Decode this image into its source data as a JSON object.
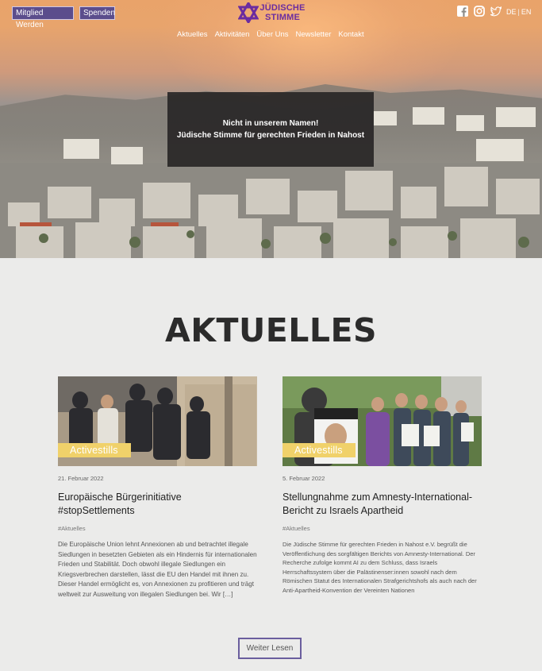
{
  "header": {
    "member_button": "Mitglied Werden",
    "donate_button": "Spenden",
    "logo_text_line1": "JÜDISCHE",
    "logo_text_line2": "STIMME",
    "nav": [
      "Aktuelles",
      "Aktivitäten",
      "Über Uns",
      "Newsletter",
      "Kontakt"
    ],
    "social_icons": [
      "facebook-icon",
      "instagram-icon",
      "twitter-icon"
    ],
    "lang_de": "DE",
    "lang_sep": "|",
    "lang_en": "EN"
  },
  "hero": {
    "line1": "Nicht in unserem Namen!",
    "line2": "Jüdische Stimme für gerechten Frieden in Nahost"
  },
  "section": {
    "title": "AKTUELLES"
  },
  "posts": [
    {
      "badge": "Activestills",
      "date": "21. Februar 2022",
      "title": "Europäische Bürgerinitiative #stopSettlements",
      "tag": "#Aktuelles",
      "excerpt": "Die Europäische Union lehnt Annexionen ab und betrachtet illegale Siedlungen in besetzten Gebieten als ein Hindernis für internationalen Frieden und Stabilität. Doch obwohl illegale Siedlungen ein Kriegsverbrechen darstellen, lässt die EU den Handel mit ihnen zu. Dieser Handel ermöglicht es, von Annexionen zu profitieren und trägt weltweit zur Ausweitung von illegalen Siedlungen bei. Wir […]"
    },
    {
      "badge": "Activestills",
      "date": "5. Februar 2022",
      "title": "Stellungnahme zum Amnesty-International-Bericht zu Israels Apartheid",
      "tag": "#Aktuelles",
      "excerpt": "Die Jüdische Stimme für gerechten Frieden in Nahost e.V. begrüßt die Veröffentlichung des sorgfältigen Berichts von Amnesty-International. Der Recherche zufolge kommt AI zu dem Schluss, dass Israels Herrschaftssystem über die Palästinenser:innen sowohl nach dem Römischen Statut des Internationalen Strafgerichtshofs als auch nach der Anti-Apartheid-Konvention der Vereinten Nationen"
    }
  ],
  "more_button": "Weiter Lesen",
  "colors": {
    "brand_purple": "#5b4d8c",
    "logo_purple": "#6b2ca0",
    "badge_yellow": "#f0d16a"
  }
}
